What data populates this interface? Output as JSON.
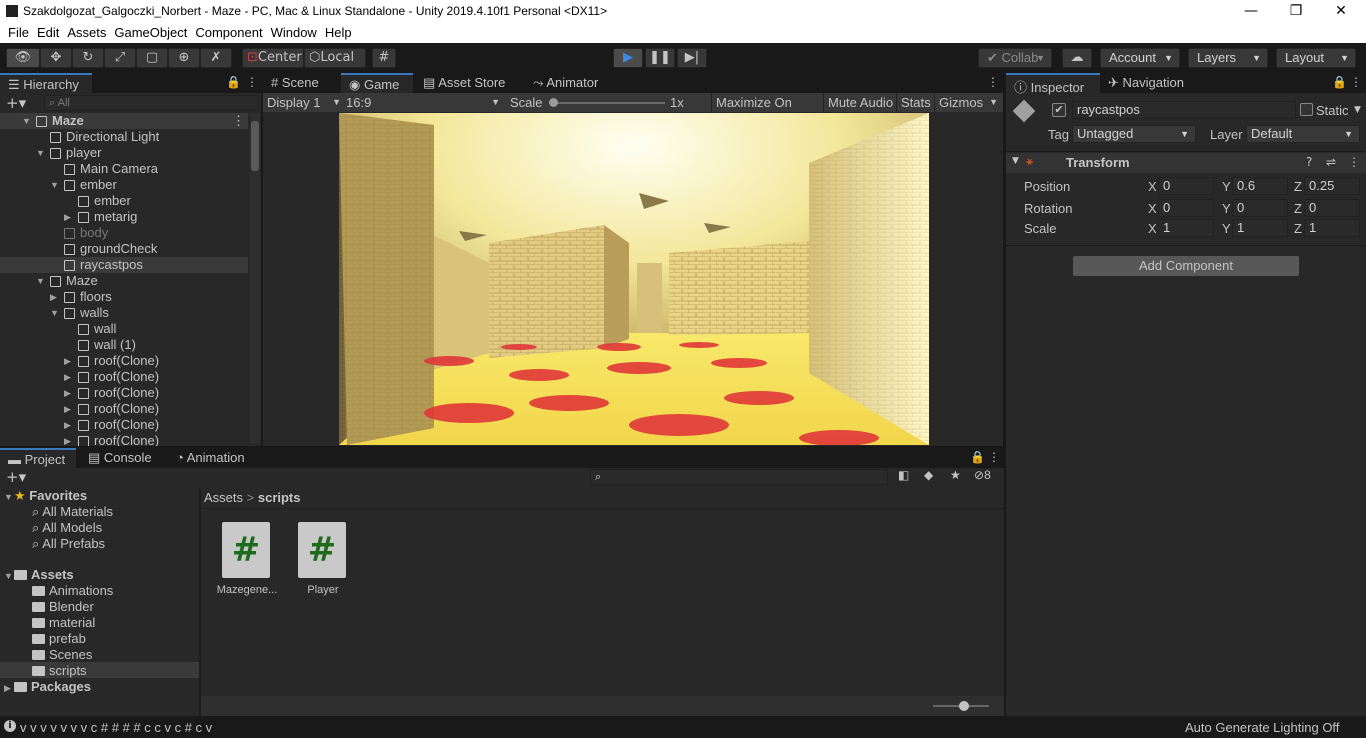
{
  "window": {
    "title": "Szakdolgozat_Galgoczki_Norbert - Maze - PC, Mac & Linux Standalone - Unity 2019.4.10f1 Personal <DX11>",
    "minimize": "—",
    "maximize": "❐",
    "close": "✕"
  },
  "menu": [
    "File",
    "Edit",
    "Assets",
    "GameObject",
    "Component",
    "Window",
    "Help"
  ],
  "toolbar": {
    "center_label": "Center",
    "local_label": "Local",
    "collab_label": "Collab",
    "account_label": "Account",
    "layers_label": "Layers",
    "layout_label": "Layout"
  },
  "hierarchy": {
    "tab": "Hierarchy",
    "search_placeholder": "All",
    "rows": [
      {
        "label": "Maze",
        "indent": 0,
        "expanded": true,
        "scene": true
      },
      {
        "label": "Directional Light",
        "indent": 1
      },
      {
        "label": "player",
        "indent": 1,
        "expanded": true
      },
      {
        "label": "Main Camera",
        "indent": 2
      },
      {
        "label": "ember",
        "indent": 2,
        "expanded": true
      },
      {
        "label": "ember",
        "indent": 3
      },
      {
        "label": "metarig",
        "indent": 3,
        "collapsed": true
      },
      {
        "label": "body",
        "indent": 2,
        "dim": true
      },
      {
        "label": "groundCheck",
        "indent": 2
      },
      {
        "label": "raycastpos",
        "indent": 2,
        "selected": true
      },
      {
        "label": "Maze",
        "indent": 1,
        "expanded": true
      },
      {
        "label": "floors",
        "indent": 2,
        "collapsed": true
      },
      {
        "label": "walls",
        "indent": 2,
        "expanded": true
      },
      {
        "label": "wall",
        "indent": 3
      },
      {
        "label": "wall (1)",
        "indent": 3
      },
      {
        "label": "roof(Clone)",
        "indent": 3,
        "collapsed": true
      },
      {
        "label": "roof(Clone)",
        "indent": 3,
        "collapsed": true
      },
      {
        "label": "roof(Clone)",
        "indent": 3,
        "collapsed": true
      },
      {
        "label": "roof(Clone)",
        "indent": 3,
        "collapsed": true
      },
      {
        "label": "roof(Clone)",
        "indent": 3,
        "collapsed": true
      },
      {
        "label": "roof(Clone)",
        "indent": 3,
        "collapsed": true
      }
    ]
  },
  "game": {
    "tabs": [
      "Scene",
      "Game",
      "Asset Store",
      "Animator"
    ],
    "display": "Display 1",
    "aspect": "16:9",
    "scale_label": "Scale",
    "scale_value": "1x",
    "maximize": "Maximize On Play",
    "mute": "Mute Audio",
    "stats": "Stats",
    "gizmos": "Gizmos"
  },
  "inspector": {
    "tabs": [
      "Inspector",
      "Navigation"
    ],
    "object_name": "raycastpos",
    "static_label": "Static",
    "tag_label": "Tag",
    "tag_value": "Untagged",
    "layer_label": "Layer",
    "layer_value": "Default",
    "component": "Transform",
    "position": {
      "label": "Position",
      "x": "0",
      "y": "0.6",
      "z": "0.25"
    },
    "rotation": {
      "label": "Rotation",
      "x": "0",
      "y": "0",
      "z": "0"
    },
    "scale": {
      "label": "Scale",
      "x": "1",
      "y": "1",
      "z": "1"
    },
    "axis": {
      "x": "X",
      "y": "Y",
      "z": "Z"
    },
    "add_component": "Add Component"
  },
  "project": {
    "tabs": [
      "Project",
      "Console",
      "Animation"
    ],
    "hidden_count": "8",
    "favorites_label": "Favorites",
    "favorites": [
      "All Materials",
      "All Models",
      "All Prefabs"
    ],
    "assets_label": "Assets",
    "folders": [
      "Animations",
      "Blender",
      "material",
      "prefab",
      "Scenes",
      "scripts"
    ],
    "packages_label": "Packages",
    "breadcrumb": {
      "root": "Assets",
      "sep": ">",
      "current": "scripts"
    },
    "files": [
      {
        "name": "Mazegene...",
        "glyph": "#"
      },
      {
        "name": "Player",
        "glyph": "#"
      }
    ]
  },
  "statusbar": {
    "left": "v v v v v v v c # # # # c c v c # c v",
    "right": "Auto Generate Lighting Off"
  }
}
